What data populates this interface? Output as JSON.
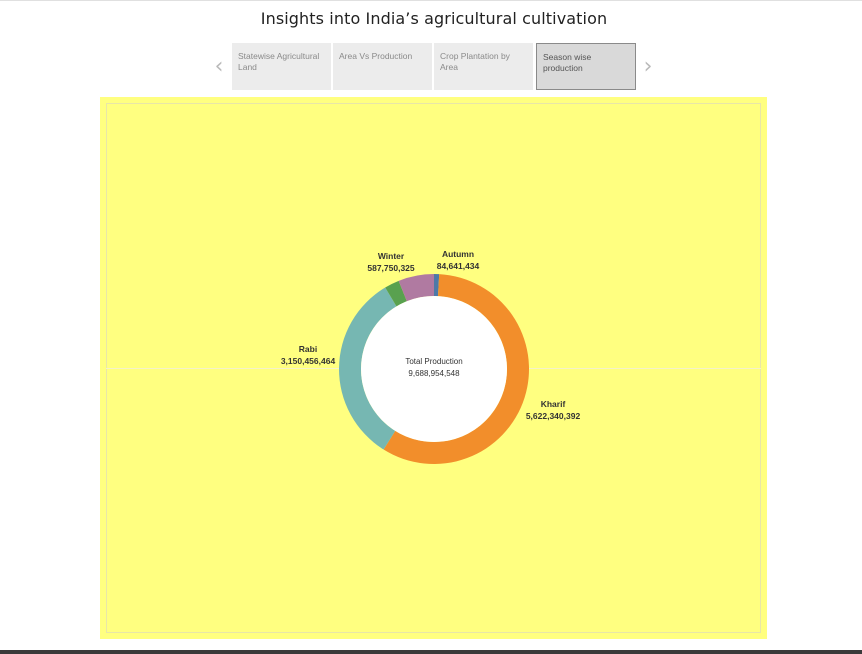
{
  "header": {
    "title": "Insights into India’s agricultural cultivation"
  },
  "tabs": [
    {
      "label": "Statewise Agricultural Land",
      "active": false
    },
    {
      "label": "Area Vs Production",
      "active": false
    },
    {
      "label": "Crop Plantation by Area",
      "active": false
    },
    {
      "label": "Season wise production",
      "active": true
    }
  ],
  "nav": {
    "prev_icon": "chevron-left-icon",
    "next_icon": "chevron-right-icon"
  },
  "colors": {
    "background": "#ffff80",
    "Kharif": "#f28e2b",
    "Rabi": "#76b7b2",
    "Whole Year": "#59a14f",
    "Winter": "#b07aa1",
    "Autumn": "#4e79a7"
  },
  "chart_data": {
    "type": "pie",
    "center_label": "Total Production",
    "center_value": "9,688,954,548",
    "slices": [
      {
        "name": "Autumn",
        "value": 84641434,
        "label": "84,641,434",
        "color": "#4e79a7"
      },
      {
        "name": "Kharif",
        "value": 5622340392,
        "label": "5,622,340,392",
        "color": "#f28e2b"
      },
      {
        "name": "Rabi",
        "value": 3150456464,
        "label": "3,150,456,464",
        "color": "#76b7b2"
      },
      {
        "name": "",
        "value": 243766433,
        "label": "",
        "color": "#59a14f"
      },
      {
        "name": "Winter",
        "value": 587750325,
        "label": "587,750,325",
        "color": "#b07aa1"
      }
    ]
  }
}
